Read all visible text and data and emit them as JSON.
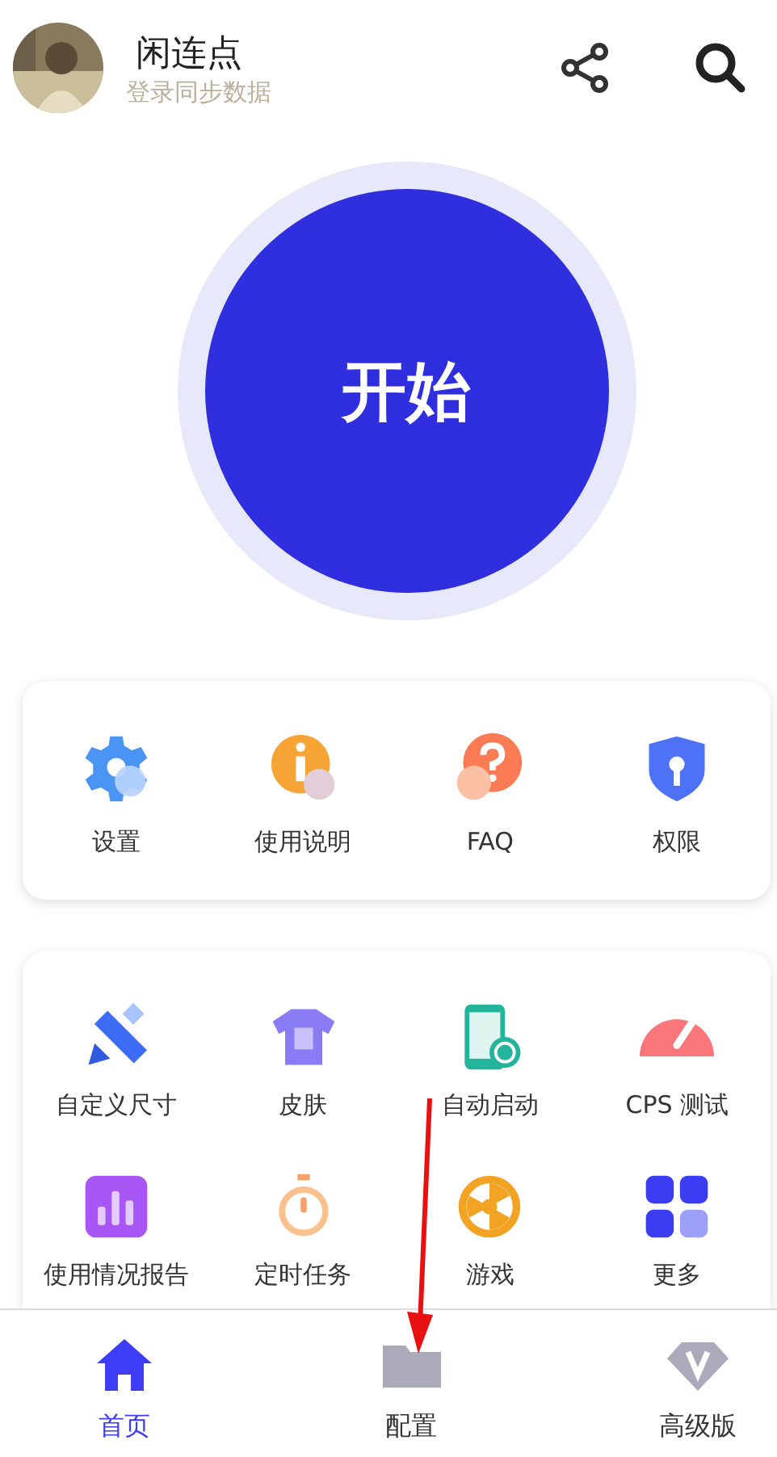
{
  "header": {
    "title": "闲连点",
    "subtitle": "登录同步数据"
  },
  "start_button": {
    "label": "开始"
  },
  "quick_menu": [
    {
      "kind": "gear",
      "label": "设置"
    },
    {
      "kind": "info",
      "label": "使用说明"
    },
    {
      "kind": "question",
      "label": "FAQ"
    },
    {
      "kind": "shield",
      "label": "权限"
    }
  ],
  "tools": [
    {
      "kind": "ruler",
      "label": "自定义尺寸"
    },
    {
      "kind": "shirt",
      "label": "皮肤"
    },
    {
      "kind": "phone",
      "label": "自动启动"
    },
    {
      "kind": "gauge",
      "label": "CPS 测试"
    },
    {
      "kind": "chart",
      "label": "使用情况报告"
    },
    {
      "kind": "timer",
      "label": "定时任务"
    },
    {
      "kind": "wheel",
      "label": "游戏"
    },
    {
      "kind": "grid",
      "label": "更多"
    }
  ],
  "bottom_nav": [
    {
      "kind": "home",
      "label": "首页",
      "selected": true
    },
    {
      "kind": "folder",
      "label": "配置",
      "selected": false
    },
    {
      "kind": "diamond",
      "label": "高级版",
      "selected": false
    }
  ]
}
